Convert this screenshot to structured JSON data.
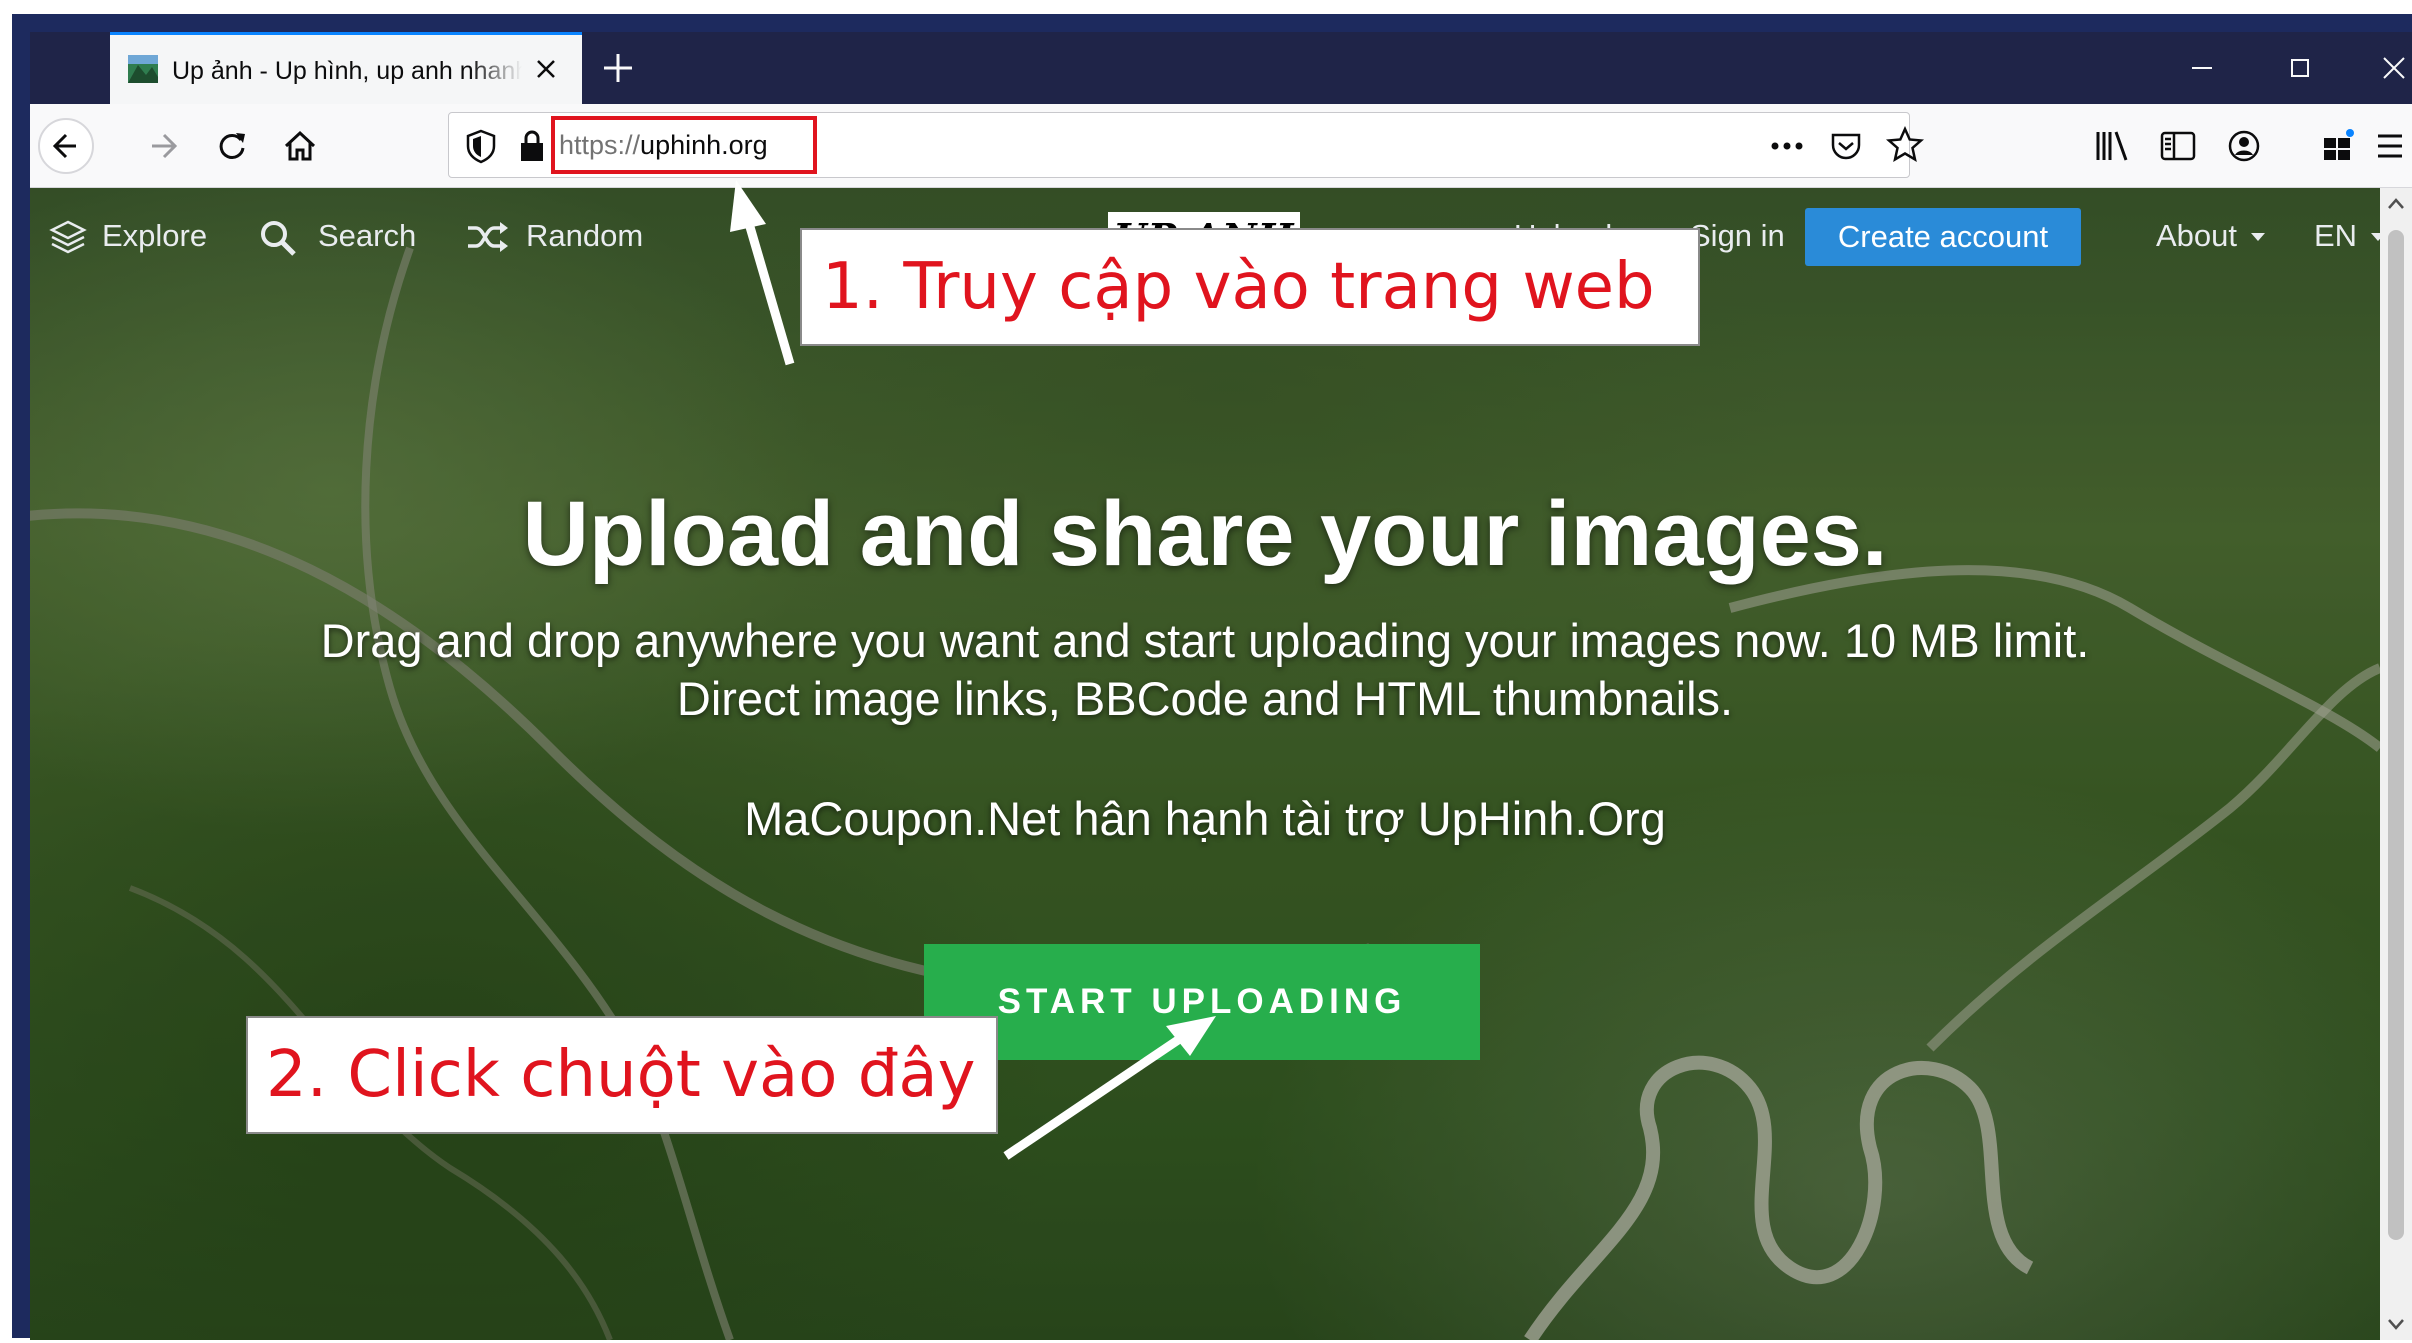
{
  "browser": {
    "tab_title": "Up ảnh - Up hình, up anh nhanh",
    "url_scheme": "https://",
    "url_host": "uphinh.org"
  },
  "site_nav": {
    "explore": "Explore",
    "search": "Search",
    "random": "Random",
    "logo": "UP ANH",
    "upload": "Upload",
    "sign_in": "Sign in",
    "create_account": "Create account",
    "about": "About",
    "language": "EN"
  },
  "hero": {
    "title": "Upload and share your images.",
    "description": "Drag and drop anywhere you want and start uploading your images now. 10 MB limit. Direct image links, BBCode and HTML thumbnails.",
    "sponsor": "MaCoupon.Net hân hạnh tài trợ UpHinh.Org",
    "start_button": "START UPLOADING"
  },
  "annotations": {
    "step1": "1. Truy cập vào trang web",
    "step2": "2. Click chuột vào đây"
  },
  "colors": {
    "frame": "#1d2a5e",
    "create_account_bg": "#2a8bd8",
    "start_button_bg": "#27ae4c",
    "annotation_red": "#e0141e"
  }
}
